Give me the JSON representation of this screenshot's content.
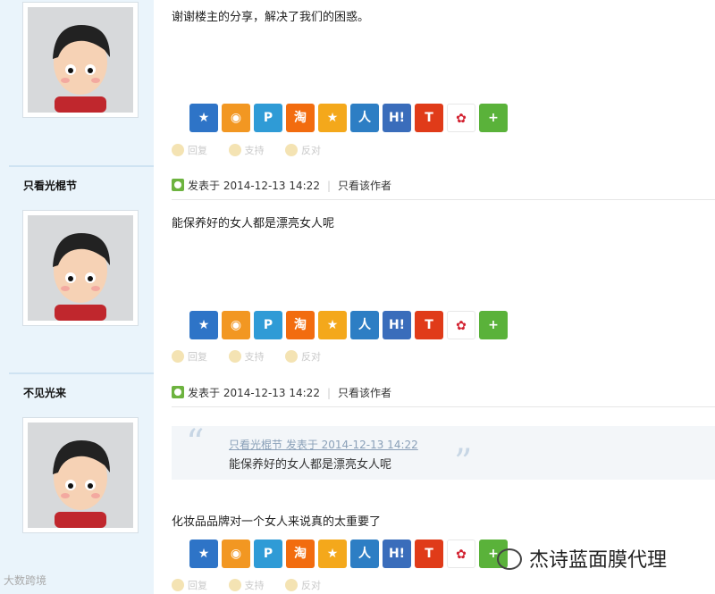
{
  "posts": [
    {
      "author": "",
      "meta": null,
      "text": "谢谢楼主的分享，解决了我们的困惑。",
      "actions": {
        "reply": "回复",
        "support": "支持",
        "oppose": "反对"
      }
    },
    {
      "author": "只看光棍节",
      "meta": {
        "posted": "发表于 2014-12-13 14:22",
        "only_author": "只看该作者"
      },
      "text": "能保养好的女人都是漂亮女人呢",
      "actions": {
        "reply": "回复",
        "support": "支持",
        "oppose": "反对"
      }
    },
    {
      "author": "不见光来",
      "meta": {
        "posted": "发表于 2014-12-13 14:22",
        "only_author": "只看该作者"
      },
      "quote": {
        "author": "只看光棍节 发表于 2014-12-13 14:22",
        "text": "能保养好的女人都是漂亮女人呢"
      },
      "text": "化妆品品牌对一个女人来说真的太重要了",
      "actions": {
        "reply": "回复",
        "support": "支持",
        "oppose": "反对"
      }
    }
  ],
  "share_icons": [
    "qzone-icon",
    "weibo-icon",
    "pinterest-icon",
    "taobao-icon",
    "star-icon",
    "renren-icon",
    "hi-icon",
    "tencent-weibo-icon",
    "weibo-red-icon",
    "more-plus-icon"
  ],
  "share_glyphs": {
    "qzone": "★",
    "weibo": "◉",
    "p": "P",
    "tao": "淘",
    "star": "★",
    "renren": "人",
    "hi": "H!",
    "t": "T",
    "wb2": "✿",
    "plus": "+"
  },
  "watermarks": {
    "left": "大数跨境",
    "right": "杰诗蓝面膜代理"
  }
}
